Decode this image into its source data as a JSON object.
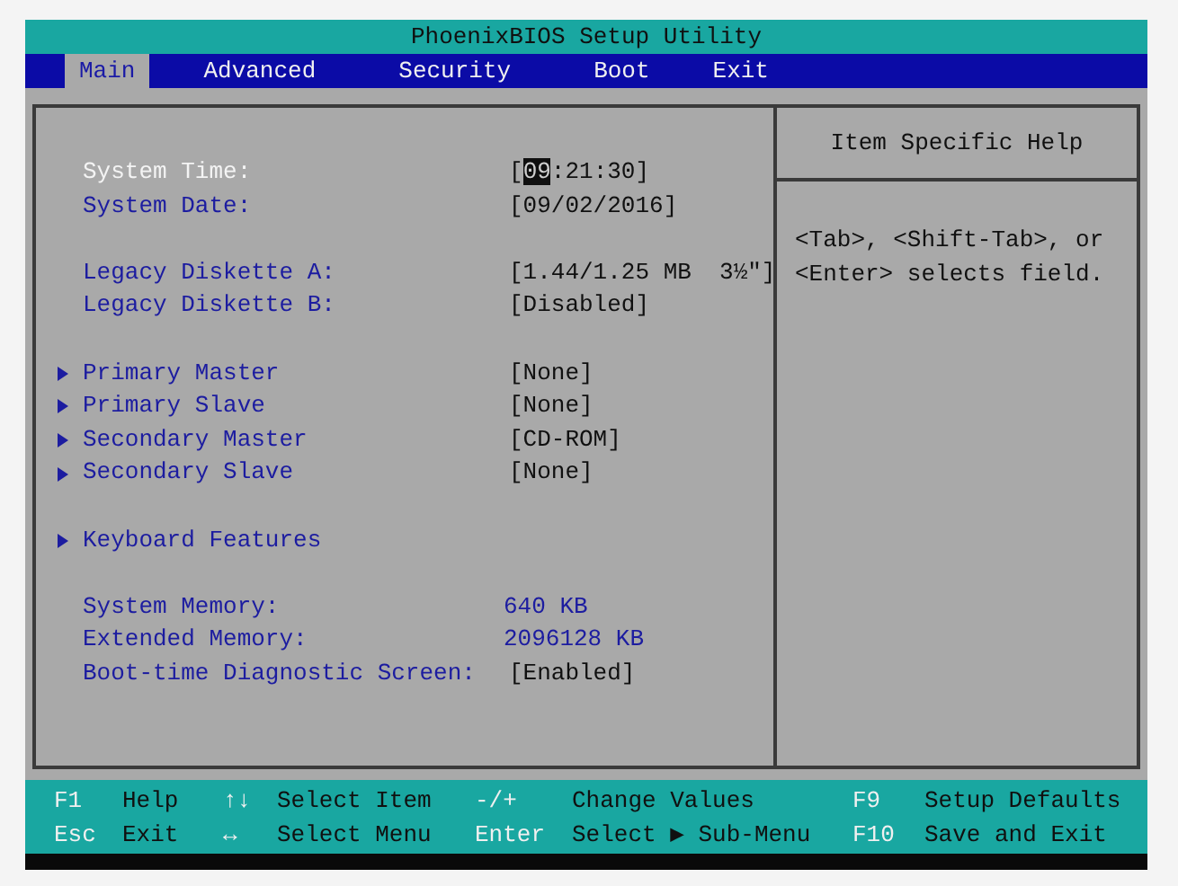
{
  "window": {
    "title": "PhoenixBIOS Setup Utility"
  },
  "tabs": [
    {
      "label": "Main",
      "selected": true
    },
    {
      "label": "Advanced",
      "selected": false
    },
    {
      "label": "Security",
      "selected": false
    },
    {
      "label": "Boot",
      "selected": false
    },
    {
      "label": "Exit",
      "selected": false
    }
  ],
  "settings": [
    {
      "items": [
        {
          "label": "System Time:",
          "selected": true,
          "submenu": false,
          "editable": true,
          "value_segments": [
            {
              "text": "[",
              "highlighted": false
            },
            {
              "text": "09",
              "highlighted": true
            },
            {
              "text": ":21:30]",
              "highlighted": false
            }
          ]
        },
        {
          "label": "System Date:",
          "selected": false,
          "submenu": false,
          "editable": true,
          "value": "[09/02/2016]"
        }
      ]
    },
    {
      "items": [
        {
          "label": "Legacy Diskette A:",
          "selected": false,
          "submenu": false,
          "editable": true,
          "value": "[1.44/1.25 MB  3½\"]"
        },
        {
          "label": "Legacy Diskette B:",
          "selected": false,
          "submenu": false,
          "editable": true,
          "value": "[Disabled]"
        }
      ]
    },
    {
      "items": [
        {
          "label": "Primary Master",
          "selected": false,
          "submenu": true,
          "editable": true,
          "value": "[None]"
        },
        {
          "label": "Primary Slave",
          "selected": false,
          "submenu": true,
          "editable": true,
          "value": "[None]"
        },
        {
          "label": "Secondary Master",
          "selected": false,
          "submenu": true,
          "editable": true,
          "value": "[CD-ROM]"
        },
        {
          "label": "Secondary Slave",
          "selected": false,
          "submenu": true,
          "editable": true,
          "value": "[None]"
        }
      ]
    },
    {
      "items": [
        {
          "label": "Keyboard Features",
          "selected": false,
          "submenu": true
        }
      ]
    },
    {
      "items": [
        {
          "label": "System Memory:",
          "selected": false,
          "submenu": false,
          "editable": false,
          "value": "640 KB"
        },
        {
          "label": "Extended Memory:",
          "selected": false,
          "submenu": false,
          "editable": false,
          "value": "2096128 KB"
        },
        {
          "label": "Boot-time Diagnostic Screen:",
          "selected": false,
          "submenu": false,
          "editable": true,
          "value": "[Enabled]"
        }
      ]
    }
  ],
  "help": {
    "title": "Item Specific Help",
    "lines": [
      "<Tab>, <Shift-Tab>, or",
      "<Enter> selects field."
    ]
  },
  "status_bar": [
    {
      "key": "F1",
      "action": "Help"
    },
    {
      "key": "↑↓",
      "action": "Select Item"
    },
    {
      "key": "-/+",
      "action": "Change Values"
    },
    {
      "key": "F9",
      "action": "Setup Defaults"
    },
    {
      "key": "Esc",
      "action": "Exit"
    },
    {
      "key": "↔",
      "action": "Select Menu"
    },
    {
      "key": "Enter",
      "action": "Select ▶ Sub-Menu"
    },
    {
      "key": "F10",
      "action": "Save and Exit"
    }
  ]
}
